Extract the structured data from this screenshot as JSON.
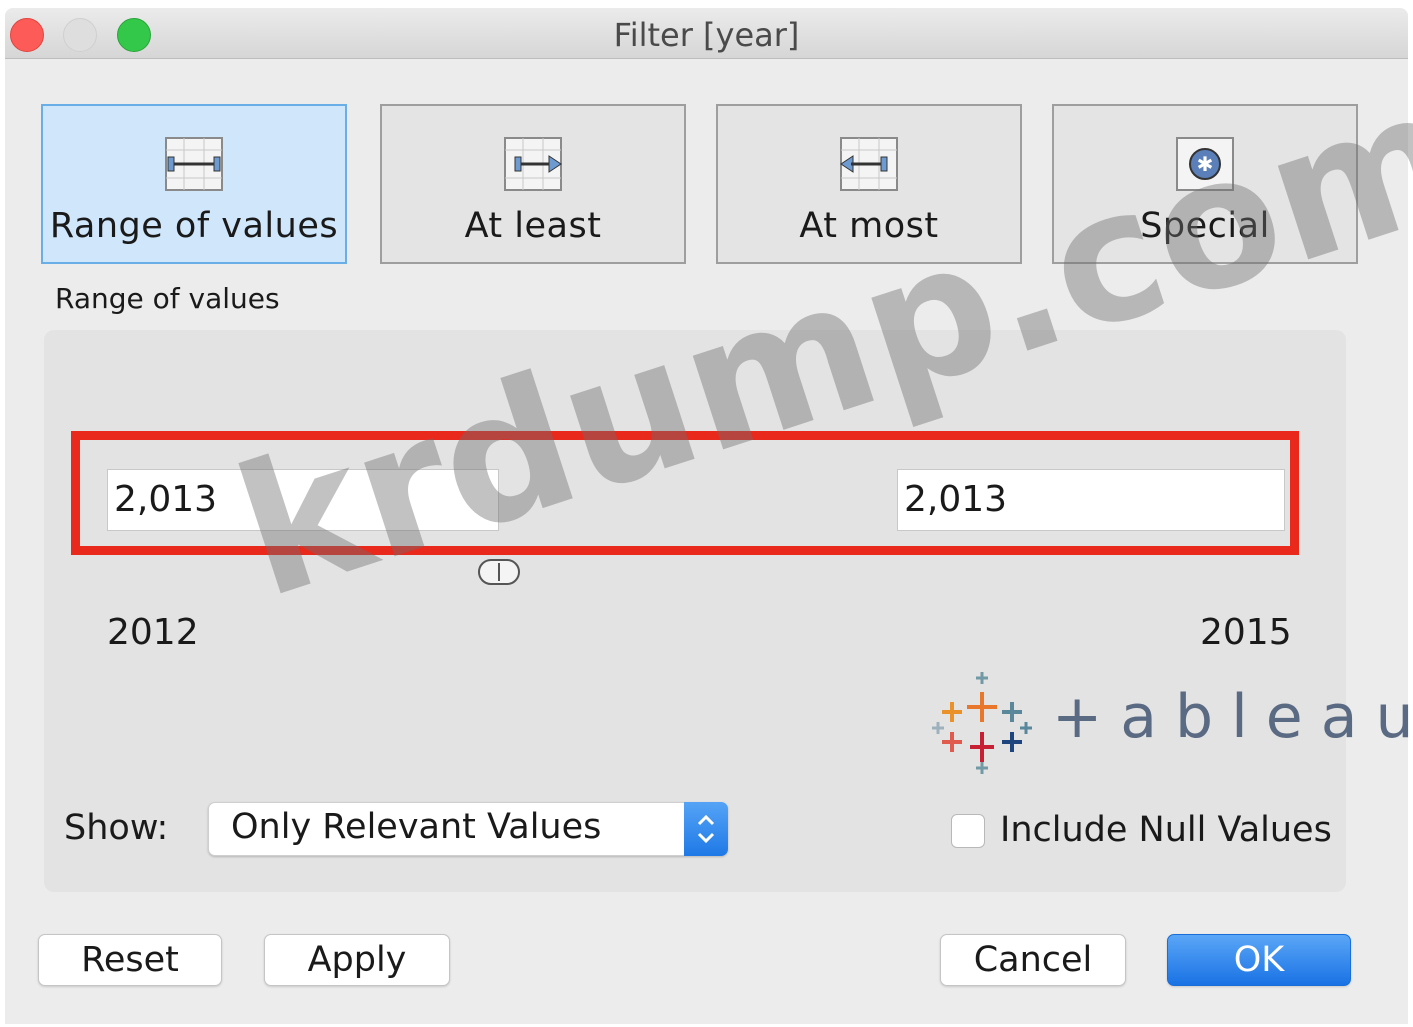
{
  "window": {
    "title": "Filter [year]"
  },
  "modes": [
    {
      "label": "Range of values",
      "icon": "range-icon",
      "selected": true
    },
    {
      "label": "At least",
      "icon": "at-least-icon",
      "selected": false
    },
    {
      "label": "At most",
      "icon": "at-most-icon",
      "selected": false
    },
    {
      "label": "Special",
      "icon": "special-icon",
      "selected": false
    }
  ],
  "section_label": "Range of values",
  "range": {
    "min_value": "2,013",
    "max_value": "2,013",
    "min_label": "2012",
    "max_label": "2015"
  },
  "logo_text": "+ableau",
  "show": {
    "label": "Show:",
    "selected": "Only Relevant Values"
  },
  "include_null": {
    "label": "Include Null Values",
    "checked": false
  },
  "buttons": {
    "reset": "Reset",
    "apply": "Apply",
    "cancel": "Cancel",
    "ok": "OK"
  },
  "watermark": "krdump.com",
  "colors": {
    "highlight": "#e8291c",
    "selected_mode": "#cfe6fb",
    "primary_button": "#1a72e4"
  }
}
